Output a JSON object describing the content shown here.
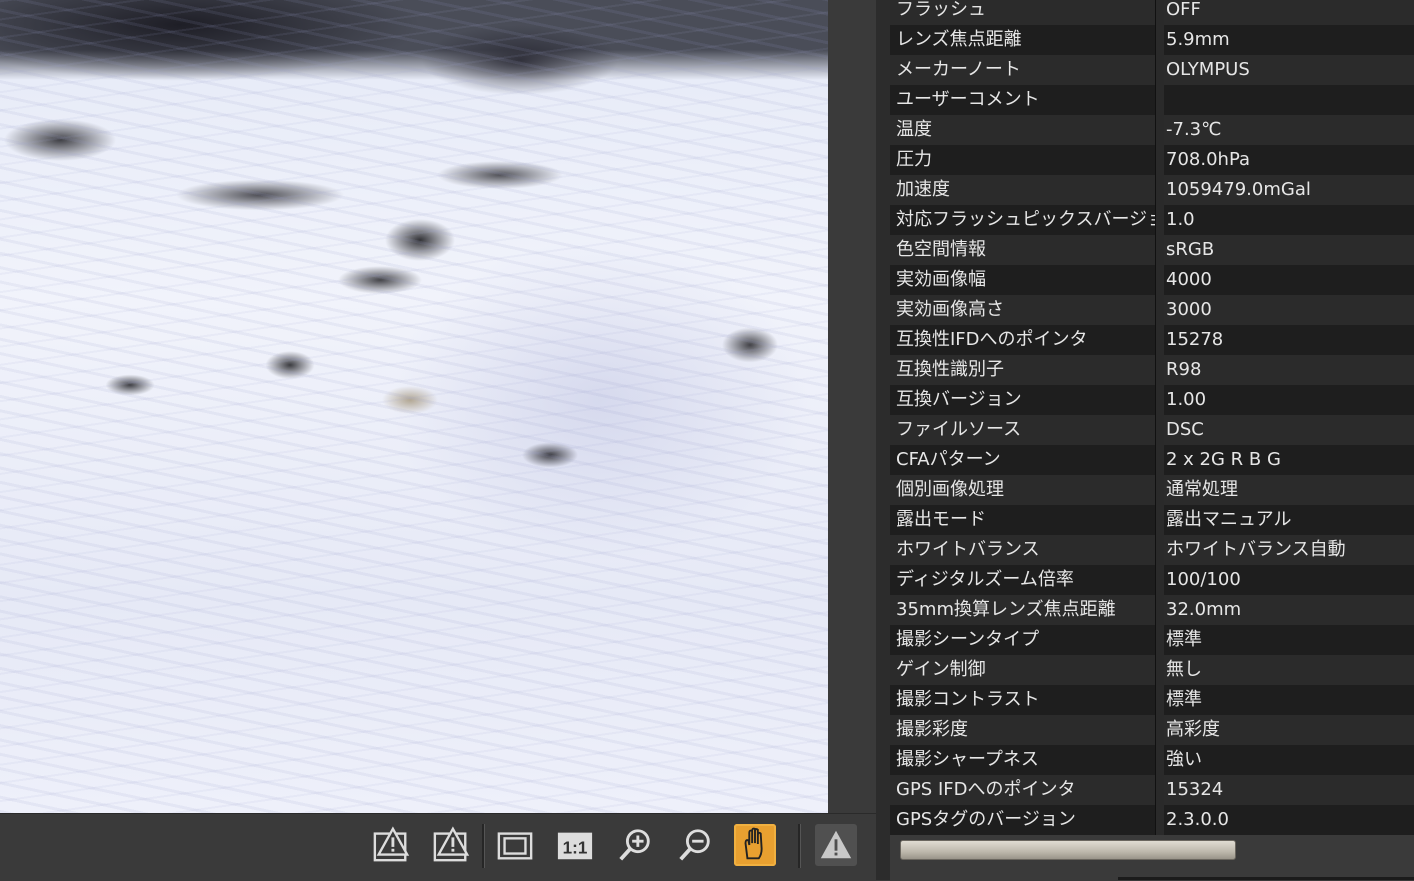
{
  "toolbar": {
    "buttons": [
      {
        "name": "shadow-warning-icon"
      },
      {
        "name": "highlight-warning-icon"
      },
      {
        "name": "fit-to-window-icon"
      },
      {
        "name": "actual-size-label",
        "label": "1:1"
      },
      {
        "name": "zoom-in-icon"
      },
      {
        "name": "zoom-out-icon"
      },
      {
        "name": "hand-tool-icon",
        "active": true
      },
      {
        "name": "warning-icon"
      }
    ],
    "active_color": "#e8a030"
  },
  "exif": [
    {
      "key": "フラッシュ",
      "value": "OFF"
    },
    {
      "key": "レンズ焦点距離",
      "value": "5.9mm"
    },
    {
      "key": "メーカーノート",
      "value": "OLYMPUS"
    },
    {
      "key": "ユーザーコメント",
      "value": ""
    },
    {
      "key": "温度",
      "value": "-7.3℃"
    },
    {
      "key": "圧力",
      "value": "708.0hPa"
    },
    {
      "key": "加速度",
      "value": "1059479.0mGal"
    },
    {
      "key": "対応フラッシュピックスバージョン",
      "value": "1.0"
    },
    {
      "key": "色空間情報",
      "value": "sRGB"
    },
    {
      "key": "実効画像幅",
      "value": "4000"
    },
    {
      "key": "実効画像高さ",
      "value": "3000"
    },
    {
      "key": "互換性IFDへのポインタ",
      "value": "15278"
    },
    {
      "key": "互換性識別子",
      "value": "R98"
    },
    {
      "key": "互換バージョン",
      "value": "1.00"
    },
    {
      "key": "ファイルソース",
      "value": "DSC"
    },
    {
      "key": "CFAパターン",
      "value": "2 x 2G R B G"
    },
    {
      "key": "個別画像処理",
      "value": "通常処理"
    },
    {
      "key": "露出モード",
      "value": "露出マニュアル"
    },
    {
      "key": "ホワイトバランス",
      "value": "ホワイトバランス自動"
    },
    {
      "key": "ディジタルズーム倍率",
      "value": "100/100"
    },
    {
      "key": "35mm換算レンズ焦点距離",
      "value": "32.0mm"
    },
    {
      "key": "撮影シーンタイプ",
      "value": "標準"
    },
    {
      "key": "ゲイン制御",
      "value": "無し"
    },
    {
      "key": "撮影コントラスト",
      "value": "標準"
    },
    {
      "key": "撮影彩度",
      "value": "高彩度"
    },
    {
      "key": "撮影シャープネス",
      "value": "強い"
    },
    {
      "key": "GPS IFDへのポインタ",
      "value": "15324"
    },
    {
      "key": "GPSタグのバージョン",
      "value": "2.3.0.0"
    }
  ]
}
